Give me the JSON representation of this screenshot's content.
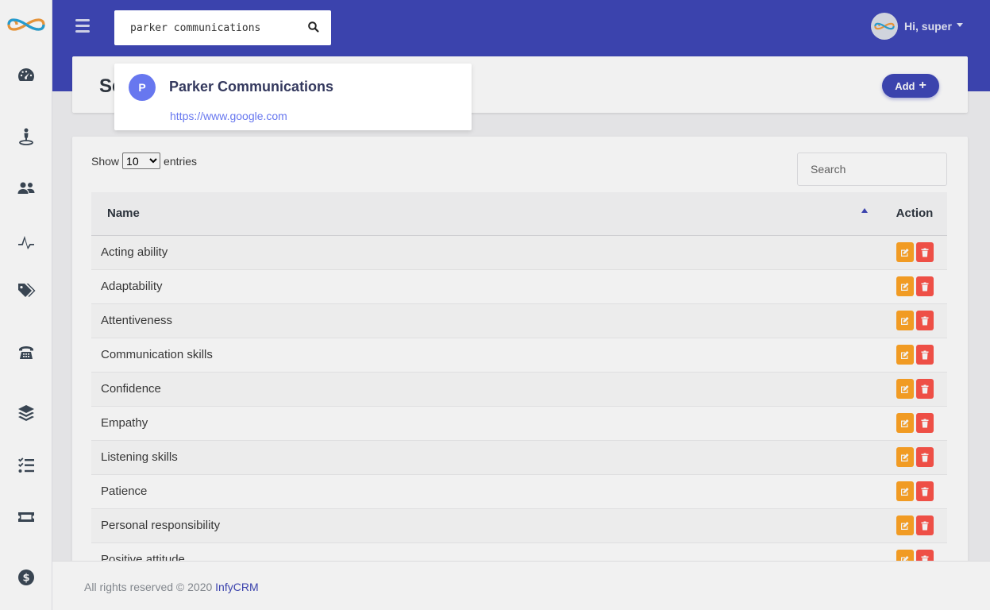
{
  "header": {
    "search_value": "parker communications",
    "user_greeting": "Hi, super"
  },
  "title_card": {
    "title": "Se",
    "add_label": "Add"
  },
  "table_controls": {
    "show_label": "Show",
    "entries_value": "10",
    "entries_label": "entries",
    "search_placeholder": "Search"
  },
  "table": {
    "columns": [
      "Name",
      "Action"
    ],
    "rows": [
      "Acting ability",
      "Adaptability",
      "Attentiveness",
      "Communication skills",
      "Confidence",
      "Empathy",
      "Listening skills",
      "Patience",
      "Personal responsibility",
      "Positive attitude"
    ]
  },
  "search_result": {
    "initial": "P",
    "name": "Parker Communications",
    "url": "https://www.google.com"
  },
  "footer": {
    "text": "All rights reserved © 2020",
    "brand": "InfyCRM"
  },
  "sidebar": {
    "icons": [
      "dashboard-icon",
      "user-location-icon",
      "users-icon",
      "chart-icon",
      "tags-icon",
      "phone-icon",
      "layers-icon",
      "tasks-icon",
      "ticket-icon",
      "money-icon"
    ]
  },
  "colors": {
    "primary": "#3f47b8",
    "accent": "#6777ef",
    "edit": "#ffa426",
    "delete": "#fc544b"
  }
}
